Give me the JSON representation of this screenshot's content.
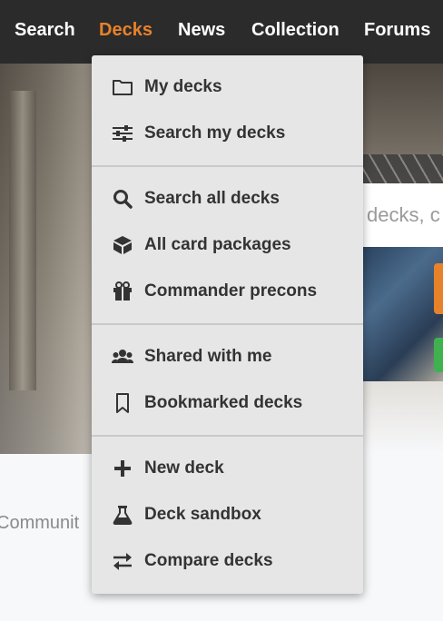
{
  "nav": {
    "items": [
      {
        "label": "Search",
        "active": false
      },
      {
        "label": "Decks",
        "active": true
      },
      {
        "label": "News",
        "active": false
      },
      {
        "label": "Collection",
        "active": false
      },
      {
        "label": "Forums",
        "active": false
      }
    ],
    "active_color": "#e8822a"
  },
  "background": {
    "search_placeholder": "decks, c",
    "community_text": "Communit"
  },
  "dropdown": {
    "groups": [
      [
        {
          "icon": "folder-icon",
          "label": "My decks"
        },
        {
          "icon": "sliders-icon",
          "label": "Search my decks"
        }
      ],
      [
        {
          "icon": "search-icon",
          "label": "Search all decks"
        },
        {
          "icon": "cube-icon",
          "label": "All card packages"
        },
        {
          "icon": "gift-icon",
          "label": "Commander precons"
        }
      ],
      [
        {
          "icon": "users-icon",
          "label": "Shared with me"
        },
        {
          "icon": "bookmark-icon",
          "label": "Bookmarked decks"
        }
      ],
      [
        {
          "icon": "plus-icon",
          "label": "New deck"
        },
        {
          "icon": "flask-icon",
          "label": "Deck sandbox"
        },
        {
          "icon": "compare-arrows-icon",
          "label": "Compare decks"
        }
      ]
    ]
  }
}
